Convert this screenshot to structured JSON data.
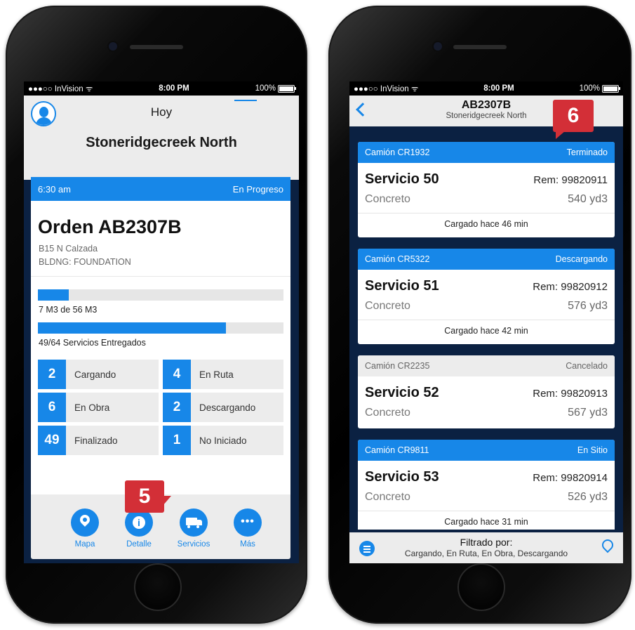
{
  "left": {
    "status": {
      "carrier": "●●●○○ InVision ᯤ",
      "time": "8:00 PM",
      "battery": "100%"
    },
    "header": {
      "title": "Hoy",
      "site": "Stoneridgecreek North"
    },
    "order": {
      "time": "6:30 am",
      "state": "En Progreso",
      "title": "Orden AB2307B",
      "address1": "B15 N Calzada",
      "address2": "BLDNG: FOUNDATION",
      "volume_label": "7 M3 de 56 M3",
      "volume_progress": 0.125,
      "services_label": "49/64 Servicios Entregados",
      "services_progress": 0.766
    },
    "stats": [
      {
        "count": "2",
        "label": "Cargando"
      },
      {
        "count": "4",
        "label": "En Ruta"
      },
      {
        "count": "6",
        "label": "En Obra"
      },
      {
        "count": "2",
        "label": "Descargando"
      },
      {
        "count": "49",
        "label": "Finalizado"
      },
      {
        "count": "1",
        "label": "No Iniciado"
      }
    ],
    "tabs": [
      {
        "label": "Mapa",
        "icon": "map-pin-icon"
      },
      {
        "label": "Detalle",
        "icon": "info-icon"
      },
      {
        "label": "Servicios",
        "icon": "truck-icon"
      },
      {
        "label": "Más",
        "icon": "more-icon"
      }
    ],
    "callout": "5"
  },
  "right": {
    "status": {
      "carrier": "●●●○○ InVision ᯤ",
      "time": "8:00 PM",
      "battery": "100%"
    },
    "header": {
      "title": "AB2307B",
      "subtitle": "Stoneridgecreek North"
    },
    "callout": "6",
    "services": [
      {
        "truck": "Camión CR1932",
        "state": "Terminado",
        "name": "Servicio 50",
        "rem": "Rem: 99820911",
        "material": "Concreto",
        "volume": "540 yd3",
        "loaded": "Cargado hace 46 min",
        "header_style": "blue"
      },
      {
        "truck": "Camión CR5322",
        "state": "Descargando",
        "name": "Servicio 51",
        "rem": "Rem: 99820912",
        "material": "Concreto",
        "volume": "576 yd3",
        "loaded": "Cargado hace 42 min",
        "header_style": "blue"
      },
      {
        "truck": "Camión CR2235",
        "state": "Cancelado",
        "name": "Servicio 52",
        "rem": "Rem: 99820913",
        "material": "Concreto",
        "volume": "567 yd3",
        "loaded": "",
        "header_style": "gray"
      },
      {
        "truck": "Camión CR9811",
        "state": "En Sitio",
        "name": "Servicio 53",
        "rem": "Rem: 99820914",
        "material": "Concreto",
        "volume": "526 yd3",
        "loaded": "Cargado hace 31 min",
        "header_style": "blue"
      }
    ],
    "filter": {
      "title": "Filtrado por:",
      "values": "Cargando, En Ruta, En Obra, Descargando"
    }
  },
  "colors": {
    "accent": "#1787e8",
    "callout": "#d32f37",
    "screen_bg": "#0b2142"
  }
}
